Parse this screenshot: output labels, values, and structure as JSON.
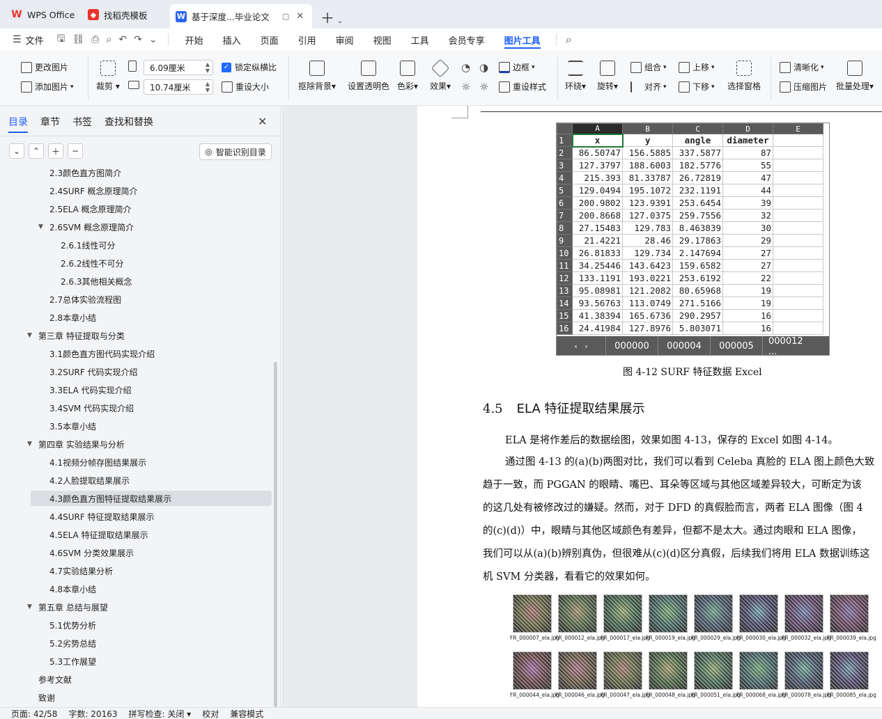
{
  "tabs": [
    {
      "label": "WPS Office",
      "icon": "wps-logo-icon",
      "color": "#e8342c"
    },
    {
      "label": "找稻壳模板",
      "icon": "docer-icon",
      "color": "#e8342c"
    },
    {
      "label": "基于深度...毕业论文",
      "icon": "word-doc-icon",
      "color": "#2a63f0"
    }
  ],
  "menu": {
    "file": "文件",
    "items": [
      "开始",
      "插入",
      "页面",
      "引用",
      "审阅",
      "视图",
      "工具",
      "会员专享",
      "图片工具"
    ],
    "active": "图片工具"
  },
  "ribbon": {
    "change_image": "更改图片",
    "add_image": "添加图片",
    "crop": "裁剪",
    "height_value": "6.09厘米",
    "width_value": "10.74厘米",
    "lock_ratio": "锁定纵横比",
    "reset_size": "重设大小",
    "remove_bg": "抠除背景",
    "set_transparent": "设置透明色",
    "color": "色彩",
    "effects": "效果",
    "border": "边框",
    "reset_style": "重设样式",
    "wrap": "环绕",
    "rotate": "旋转",
    "group": "组合",
    "align": "对齐",
    "bring_up": "上移",
    "send_down": "下移",
    "selection_pane": "选择窗格",
    "sharpen": "清晰化",
    "compress": "压缩图片",
    "batch": "批量处理"
  },
  "panel": {
    "tabs": [
      "目录",
      "章节",
      "书签",
      "查找和替换"
    ],
    "smart_toc": "智能识别目录",
    "toc": [
      {
        "label": "2.3颜色直方图简介",
        "level": 2
      },
      {
        "label": "2.4SURF 概念原理简介",
        "level": 2
      },
      {
        "label": "2.5ELA 概念原理简介",
        "level": 2
      },
      {
        "label": "2.6SVM 概念原理简介",
        "level": 2,
        "expand": true
      },
      {
        "label": "2.6.1线性可分",
        "level": 3
      },
      {
        "label": "2.6.2线性不可分",
        "level": 3
      },
      {
        "label": "2.6.3其他相关概念",
        "level": 3
      },
      {
        "label": "2.7总体实验流程图",
        "level": 2
      },
      {
        "label": "2.8本章小结",
        "level": 2
      },
      {
        "label": "第三章 特征提取与分类",
        "level": 1,
        "expand": true
      },
      {
        "label": "3.1颜色直方图代码实现介绍",
        "level": 2
      },
      {
        "label": "3.2SURF 代码实现介绍",
        "level": 2
      },
      {
        "label": "3.3ELA 代码实现介绍",
        "level": 2
      },
      {
        "label": "3.4SVM 代码实现介绍",
        "level": 2
      },
      {
        "label": "3.5本章小结",
        "level": 2
      },
      {
        "label": "第四章 实验结果与分析",
        "level": 1,
        "expand": true
      },
      {
        "label": "4.1视频分帧存图结果展示",
        "level": 2
      },
      {
        "label": "4.2人脸提取结果展示",
        "level": 2
      },
      {
        "label": "4.3颜色直方图特征提取结果展示",
        "level": 2,
        "selected": true
      },
      {
        "label": "4.4SURF 特征提取结果展示",
        "level": 2
      },
      {
        "label": "4.5ELA 特征提取结果展示",
        "level": 2
      },
      {
        "label": "4.6SVM 分类效果展示",
        "level": 2
      },
      {
        "label": "4.7实验结果分析",
        "level": 2
      },
      {
        "label": "4.8本章小结",
        "level": 2
      },
      {
        "label": "第五章 总结与展望",
        "level": 1,
        "expand": true
      },
      {
        "label": "5.1优势分析",
        "level": 2
      },
      {
        "label": "5.2劣势总结",
        "level": 2
      },
      {
        "label": "5.3工作展望",
        "level": 2
      },
      {
        "label": "参考文献",
        "level": 1
      },
      {
        "label": "致谢",
        "level": 1
      }
    ]
  },
  "excel": {
    "col_letters": [
      "A",
      "B",
      "C",
      "D",
      "E"
    ],
    "headers": [
      "x",
      "y",
      "angle",
      "diameter",
      ""
    ],
    "rows": [
      [
        "86.50747",
        "156.5885",
        "337.5877",
        "87"
      ],
      [
        "127.3797",
        "188.6003",
        "182.5776",
        "55"
      ],
      [
        "215.393",
        "81.33787",
        "26.72819",
        "47"
      ],
      [
        "129.0494",
        "195.1072",
        "232.1191",
        "44"
      ],
      [
        "200.9802",
        "123.9391",
        "253.6454",
        "39"
      ],
      [
        "200.8668",
        "127.0375",
        "259.7556",
        "32"
      ],
      [
        "27.15483",
        "129.783",
        "8.463839",
        "30"
      ],
      [
        "21.4221",
        "28.46",
        "29.17863",
        "29"
      ],
      [
        "26.81833",
        "129.734",
        "2.147694",
        "27"
      ],
      [
        "34.25446",
        "143.6423",
        "159.6582",
        "27"
      ],
      [
        "133.1191",
        "193.0221",
        "253.6192",
        "22"
      ],
      [
        "95.08981",
        "121.2082",
        "80.65968",
        "19"
      ],
      [
        "93.56763",
        "113.0749",
        "271.5166",
        "19"
      ],
      [
        "41.38394",
        "165.6736",
        "290.2957",
        "16"
      ],
      [
        "24.41984",
        "127.8976",
        "5.803071",
        "16"
      ]
    ],
    "sheets": [
      "000000",
      "000004",
      "000005",
      "000012 ..."
    ]
  },
  "doc": {
    "caption": "图  4-12 SURF 特征数据  Excel",
    "heading_num": "4.5",
    "heading_text": "ELA 特征提取结果展示",
    "paragraphs": [
      "ELA 是将作差后的数据绘图，效果如图  4-13，保存的  Excel 如图  4-14。",
      "通过图  4-13 的(a)(b)两图对比，我们可以看到  Celeba 真脸的  ELA 图上颜色大致",
      "趋于一致，而  PGGAN 的眼睛、嘴巴、耳朵等区域与其他区域差异较大，可断定为该",
      "的这几处有被修改过的嫌疑。然而，对于  DFD 的真假脸而言，两者  ELA 图像（图 4",
      "的(c)(d)）中，眼睛与其他区域颜色有差异，但都不是太大。通过肉眼和  ELA 图像，",
      "我们可以从(a)(b)辨别真伪，但很难从(c)(d)区分真假，后续我们将用  ELA 数据训练这",
      "机 SVM 分类器，看看它的效果如何。"
    ],
    "ela_images": [
      [
        "FR_000007_ela.jpg",
        "FR_000012_ela.jpg",
        "FR_000017_ela.jpg",
        "FR_000019_ela.jpg",
        "FR_000029_ela.jpg",
        "FR_000030_ela.jpg",
        "FR_000032_ela.jpg",
        "FR_000039_ela.jpg"
      ],
      [
        "FR_000044_ela.jpg",
        "FR_000046_ela.jpg",
        "FR_000047_ela.jpg",
        "FR_000048_ela.jpg",
        "FR_000051_ela.jpg",
        "FR_000068_ela.jpg",
        "FR_000078_ela.jpg",
        "FR_000085_ela.jpg"
      ]
    ]
  },
  "status": {
    "page": "页面: 42/58",
    "words": "字数: 20163",
    "spell": "拼写检查: 关闭",
    "proof": "校对",
    "compat": "兼容模式"
  },
  "colors": {
    "accent": "#1e5eff",
    "wps_red": "#e8342c",
    "excel_header": "#5a5a5a"
  }
}
